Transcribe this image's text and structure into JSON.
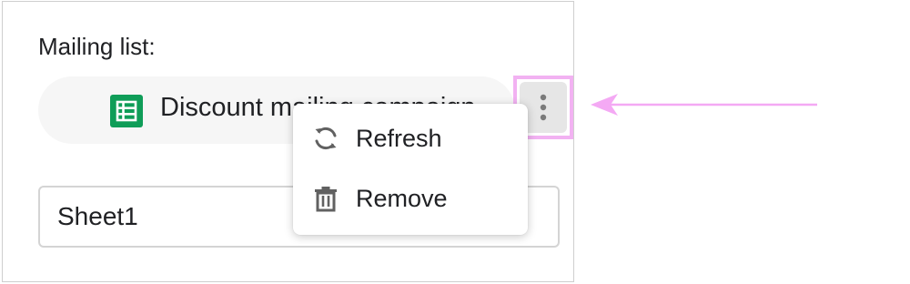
{
  "mailing_list": {
    "label": "Mailing list:",
    "file_name": "Discount mailing campaign",
    "file_icon": "google-sheets-icon",
    "more_icon": "more-vert-icon"
  },
  "sheet_field": {
    "value": "Sheet1"
  },
  "context_menu": {
    "items": [
      {
        "label": "Refresh",
        "icon": "refresh-icon"
      },
      {
        "label": "Remove",
        "icon": "trash-icon"
      }
    ]
  },
  "colors": {
    "sheets_green": "#0f9d58",
    "highlight": "#f2b2f2",
    "arrow": "#f4a9f4"
  }
}
